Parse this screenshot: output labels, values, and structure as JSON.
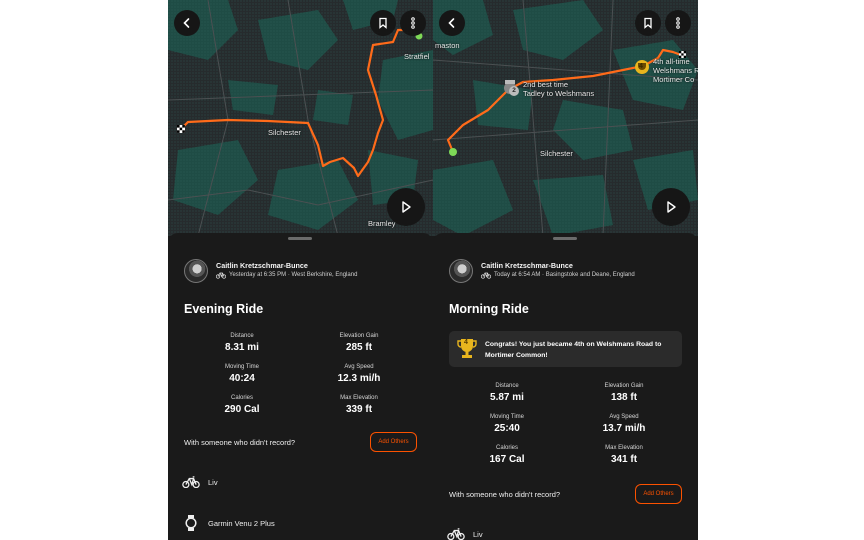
{
  "left": {
    "map": {
      "labels": [
        "Silchester",
        "Bramley",
        "Stratfiel"
      ]
    },
    "athlete": {
      "name": "Caitlin Kretzschmar-Bunce",
      "meta": "Yesterday at 6:35 PM · West Berkshire, England"
    },
    "activity_title": "Evening Ride",
    "stats": [
      {
        "label": "Distance",
        "value": "8.31 mi"
      },
      {
        "label": "Elevation Gain",
        "value": "285 ft"
      },
      {
        "label": "Moving Time",
        "value": "40:24"
      },
      {
        "label": "Avg Speed",
        "value": "12.3 mi/h"
      },
      {
        "label": "Calories",
        "value": "290 Cal"
      },
      {
        "label": "Max Elevation",
        "value": "339 ft"
      }
    ],
    "prompt": "With someone who didn't record?",
    "add_others_label": "Add Others",
    "gear": [
      {
        "icon": "bike-icon",
        "label": "Liv"
      },
      {
        "icon": "watch-icon",
        "label": "Garmin Venu 2 Plus"
      }
    ]
  },
  "right": {
    "map": {
      "labels": [
        "maston",
        "Silchester"
      ],
      "segment_badges": [
        {
          "rank": "2",
          "line1": "2nd best time",
          "line2": "Tadley to Welshmans"
        },
        {
          "rank": "4",
          "line1": "4th all-time",
          "line2": "Welshmans R",
          "line3": "Mortimer Co"
        }
      ]
    },
    "athlete": {
      "name": "Caitlin Kretzschmar-Bunce",
      "meta": "Today at 6:54 AM · Basingstoke and Deane, England"
    },
    "activity_title": "Morning Ride",
    "congrats": {
      "rank": "4",
      "text": "Congrats! You just became 4th on Welshmans Road to Mortimer Common!"
    },
    "stats": [
      {
        "label": "Distance",
        "value": "5.87 mi"
      },
      {
        "label": "Elevation Gain",
        "value": "138 ft"
      },
      {
        "label": "Moving Time",
        "value": "25:40"
      },
      {
        "label": "Avg Speed",
        "value": "13.7 mi/h"
      },
      {
        "label": "Calories",
        "value": "167 Cal"
      },
      {
        "label": "Max Elevation",
        "value": "341 ft"
      }
    ],
    "prompt": "With someone who didn't record?",
    "add_others_label": "Add Others",
    "gear": [
      {
        "icon": "bike-icon",
        "label": "Liv"
      }
    ]
  },
  "colors": {
    "accent": "#fc5200",
    "route": "#ff6b1a",
    "map_bg": "#262b2d",
    "forest": "#1f4c45",
    "sheet_bg": "#1a1a1a",
    "start_marker": "#7ed957",
    "trophy_gold": "#e8b51e"
  }
}
